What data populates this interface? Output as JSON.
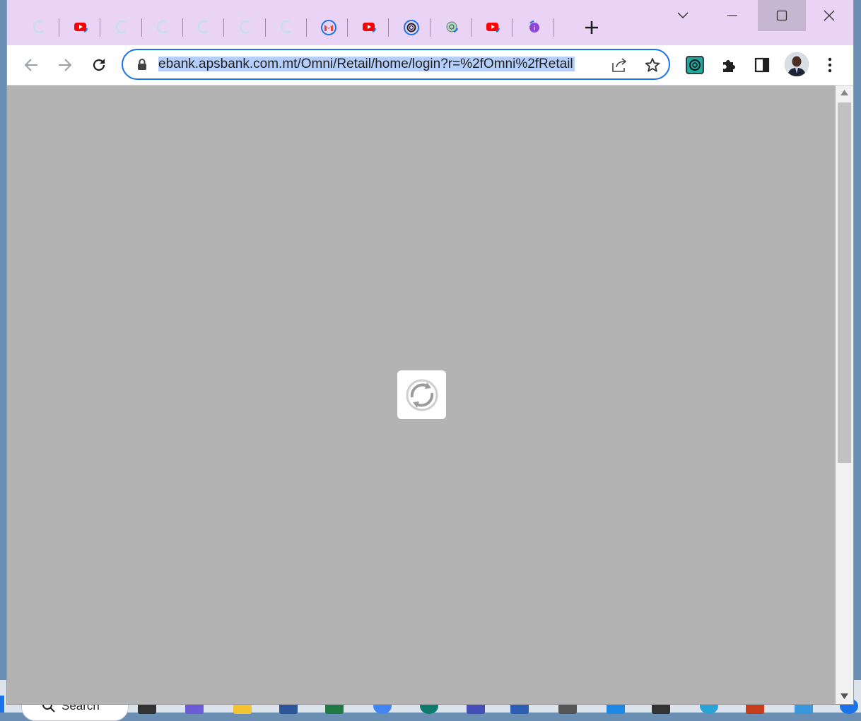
{
  "taskbar": {
    "search_label": "Search"
  },
  "tabs": [
    {
      "icon": "loading-icon"
    },
    {
      "icon": "youtube-icon"
    },
    {
      "icon": "loading-icon"
    },
    {
      "icon": "loading-icon"
    },
    {
      "icon": "loading-icon"
    },
    {
      "icon": "loading-icon"
    },
    {
      "icon": "loading-icon"
    },
    {
      "icon": "gmail-icon"
    },
    {
      "icon": "youtube-icon"
    },
    {
      "icon": "openai-icon"
    },
    {
      "icon": "chatgpt-icon"
    },
    {
      "icon": "youtube-icon"
    },
    {
      "icon": "purple-app-icon"
    }
  ],
  "address_bar": {
    "url": "ebank.apsbank.com.mt/Omni/Retail/home/login?r=%2fOmni%2fRetail"
  },
  "colors": {
    "tabstrip": "#e9d4f6",
    "accent": "#1a73e8",
    "page_overlay": "#b3b3b3"
  },
  "page": {
    "state": "loading"
  }
}
